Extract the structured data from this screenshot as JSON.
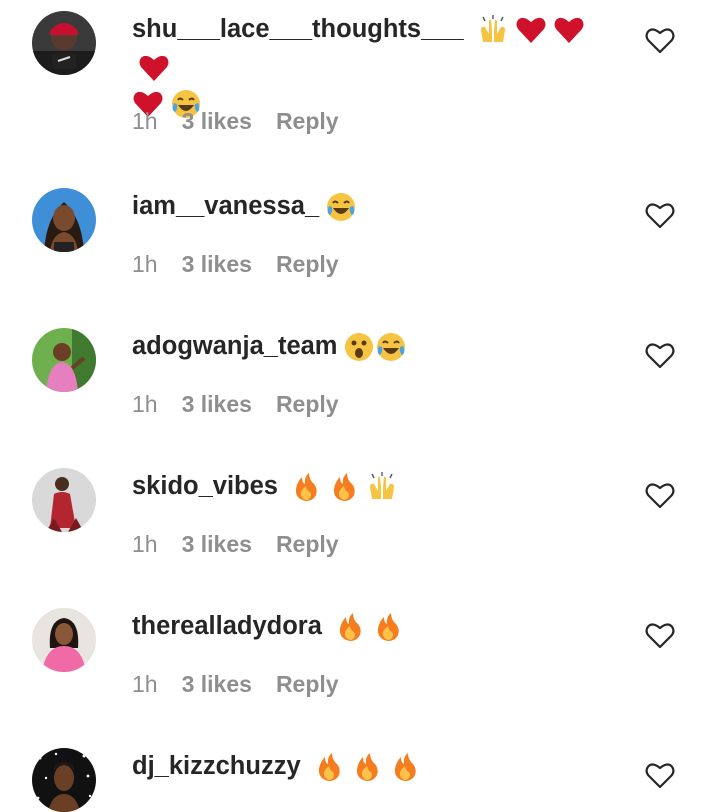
{
  "comments": [
    {
      "username": "shu___lace___thoughts___",
      "emojis": [
        "raising-hands",
        "heart",
        "heart",
        "heart",
        "heart",
        "joy"
      ],
      "time": "1h",
      "likes": "3 likes",
      "reply": "Reply",
      "avatar": "avatar-red-cap"
    },
    {
      "username": "iam__vanessa_",
      "emojis": [
        "joy"
      ],
      "time": "1h",
      "likes": "3 likes",
      "reply": "Reply",
      "avatar": "avatar-woman-blue"
    },
    {
      "username": "adogwanja_team",
      "emojis": [
        "astonished",
        "joy"
      ],
      "time": "1h",
      "likes": "3 likes",
      "reply": "Reply",
      "avatar": "avatar-pink-outfit"
    },
    {
      "username": "skido_vibes",
      "emojis": [
        "fire",
        "fire",
        "raising-hands"
      ],
      "time": "1h",
      "likes": "3 likes",
      "reply": "Reply",
      "avatar": "avatar-red-suit"
    },
    {
      "username": "therealladydora",
      "emojis": [
        "fire",
        "fire"
      ],
      "time": "1h",
      "likes": "3 likes",
      "reply": "Reply",
      "avatar": "avatar-woman-pink"
    },
    {
      "username": "dj_kizzchuzzy",
      "emojis": [
        "fire",
        "fire",
        "fire"
      ],
      "time": "",
      "likes": "",
      "reply": "",
      "avatar": "avatar-starry"
    }
  ],
  "colors": {
    "username": "#262626",
    "meta": "#8e8e8e",
    "heart_outline": "#262626"
  },
  "icons": {
    "like": "heart-outline-icon"
  }
}
